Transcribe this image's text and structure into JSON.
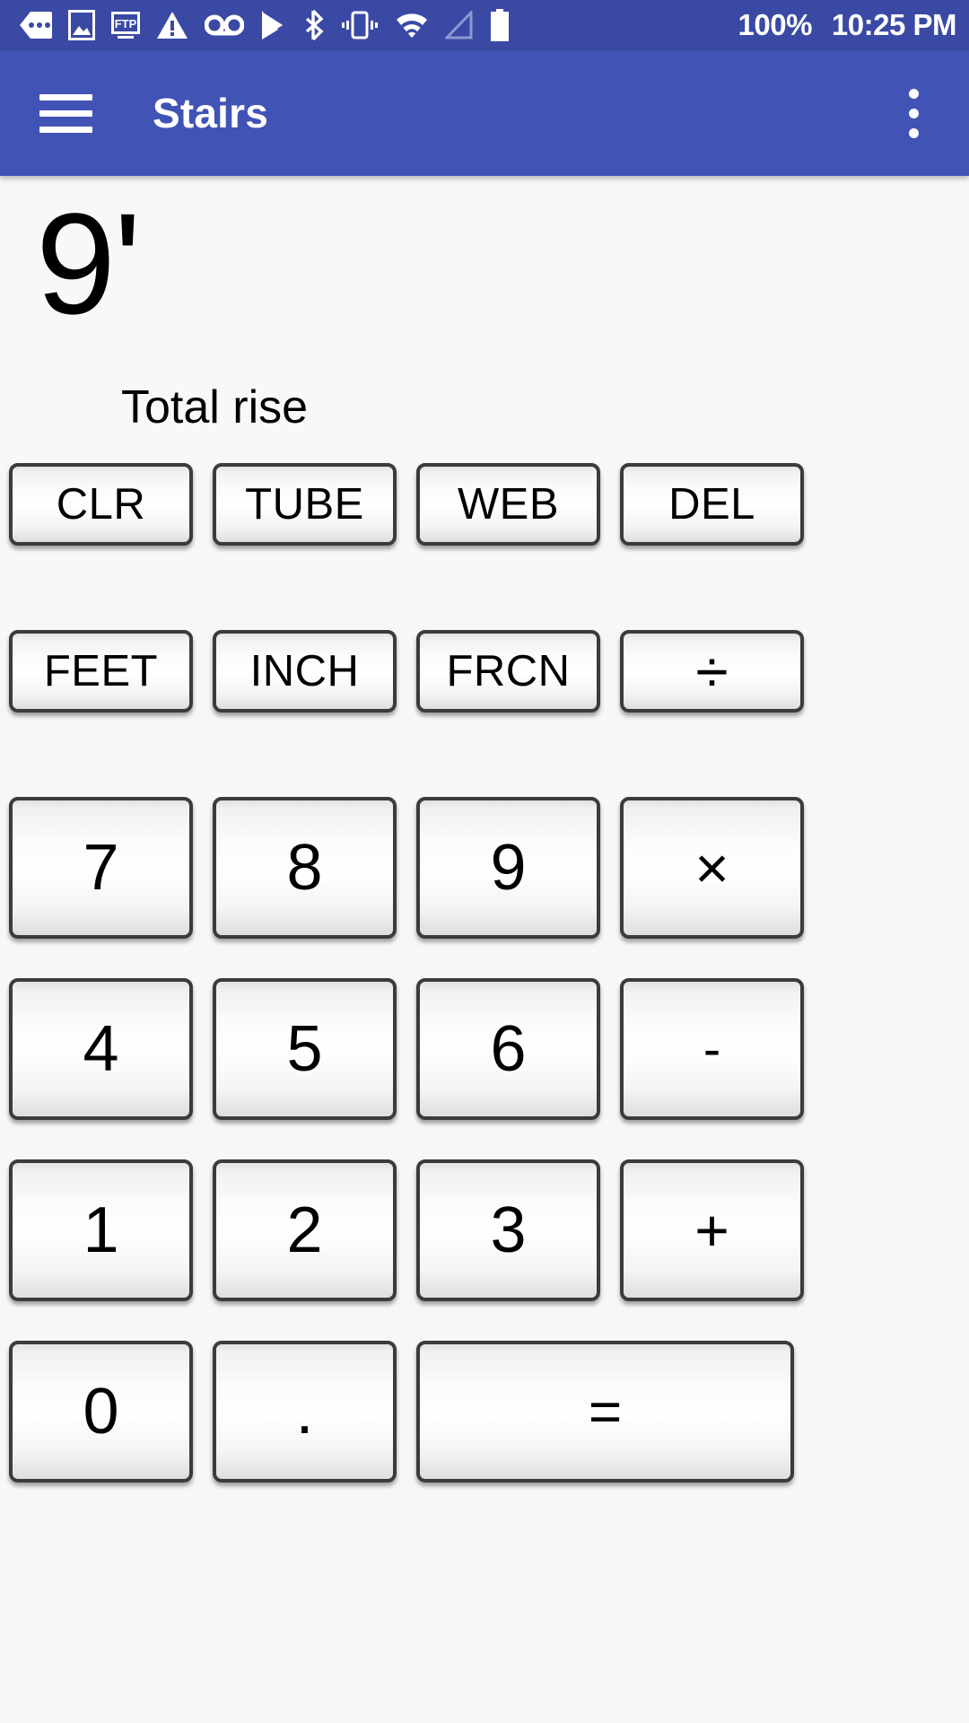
{
  "status_bar": {
    "background_color": "#3a49a4",
    "icons": [
      "message-bubble-icon",
      "photo-icon",
      "ftp-icon",
      "warning-triangle-icon",
      "voicemail-icon",
      "play-store-icon",
      "bluetooth-icon",
      "vibrate-icon",
      "wifi-icon",
      "cell-signal-icon",
      "battery-full-icon"
    ],
    "battery_percent": "100%",
    "clock": "10:25 PM"
  },
  "app_bar": {
    "background_color": "#4153b5",
    "title": "Stairs",
    "menu_icon": "hamburger-menu-icon",
    "overflow_icon": "overflow-menu-icon"
  },
  "display": {
    "value": "9'",
    "label": "Total rise"
  },
  "keypad": {
    "rows": [
      {
        "size": "small",
        "keys": [
          {
            "label": "CLR",
            "name": "key-clr",
            "style": "lbl-word",
            "width": "w1"
          },
          {
            "label": "TUBE",
            "name": "key-tube",
            "style": "lbl-word",
            "width": "w1"
          },
          {
            "label": "WEB",
            "name": "key-web",
            "style": "lbl-word",
            "width": "w1"
          },
          {
            "label": "DEL",
            "name": "key-del",
            "style": "lbl-word",
            "width": "w1"
          }
        ]
      },
      {
        "size": "small",
        "keys": [
          {
            "label": "FEET",
            "name": "key-feet",
            "style": "lbl-word",
            "width": "w1"
          },
          {
            "label": "INCH",
            "name": "key-inch",
            "style": "lbl-word",
            "width": "w1"
          },
          {
            "label": "FRCN",
            "name": "key-frcn",
            "style": "lbl-word",
            "width": "w1"
          },
          {
            "label": "÷",
            "name": "key-divide",
            "style": "lbl-op",
            "width": "w1"
          }
        ]
      },
      {
        "size": "big",
        "keys": [
          {
            "label": "7",
            "name": "key-7",
            "style": "lbl-digit",
            "width": "w1"
          },
          {
            "label": "8",
            "name": "key-8",
            "style": "lbl-digit",
            "width": "w1"
          },
          {
            "label": "9",
            "name": "key-9",
            "style": "lbl-digit",
            "width": "w1"
          },
          {
            "label": "×",
            "name": "key-multiply",
            "style": "lbl-op",
            "width": "w1"
          }
        ]
      },
      {
        "size": "big",
        "keys": [
          {
            "label": "4",
            "name": "key-4",
            "style": "lbl-digit",
            "width": "w1"
          },
          {
            "label": "5",
            "name": "key-5",
            "style": "lbl-digit",
            "width": "w1"
          },
          {
            "label": "6",
            "name": "key-6",
            "style": "lbl-digit",
            "width": "w1"
          },
          {
            "label": "-",
            "name": "key-minus",
            "style": "lbl-minus",
            "width": "w1"
          }
        ]
      },
      {
        "size": "big",
        "keys": [
          {
            "label": "1",
            "name": "key-1",
            "style": "lbl-digit",
            "width": "w1"
          },
          {
            "label": "2",
            "name": "key-2",
            "style": "lbl-digit",
            "width": "w1"
          },
          {
            "label": "3",
            "name": "key-3",
            "style": "lbl-digit",
            "width": "w1"
          },
          {
            "label": "+",
            "name": "key-plus",
            "style": "lbl-op",
            "width": "w1"
          }
        ]
      },
      {
        "size": "big",
        "keys": [
          {
            "label": "0",
            "name": "key-0",
            "style": "lbl-digit",
            "width": "w1"
          },
          {
            "label": ".",
            "name": "key-decimal",
            "style": "lbl-dot",
            "width": "w1"
          },
          {
            "label": "=",
            "name": "key-equals",
            "style": "lbl-eq",
            "width": "w2"
          }
        ]
      }
    ]
  }
}
